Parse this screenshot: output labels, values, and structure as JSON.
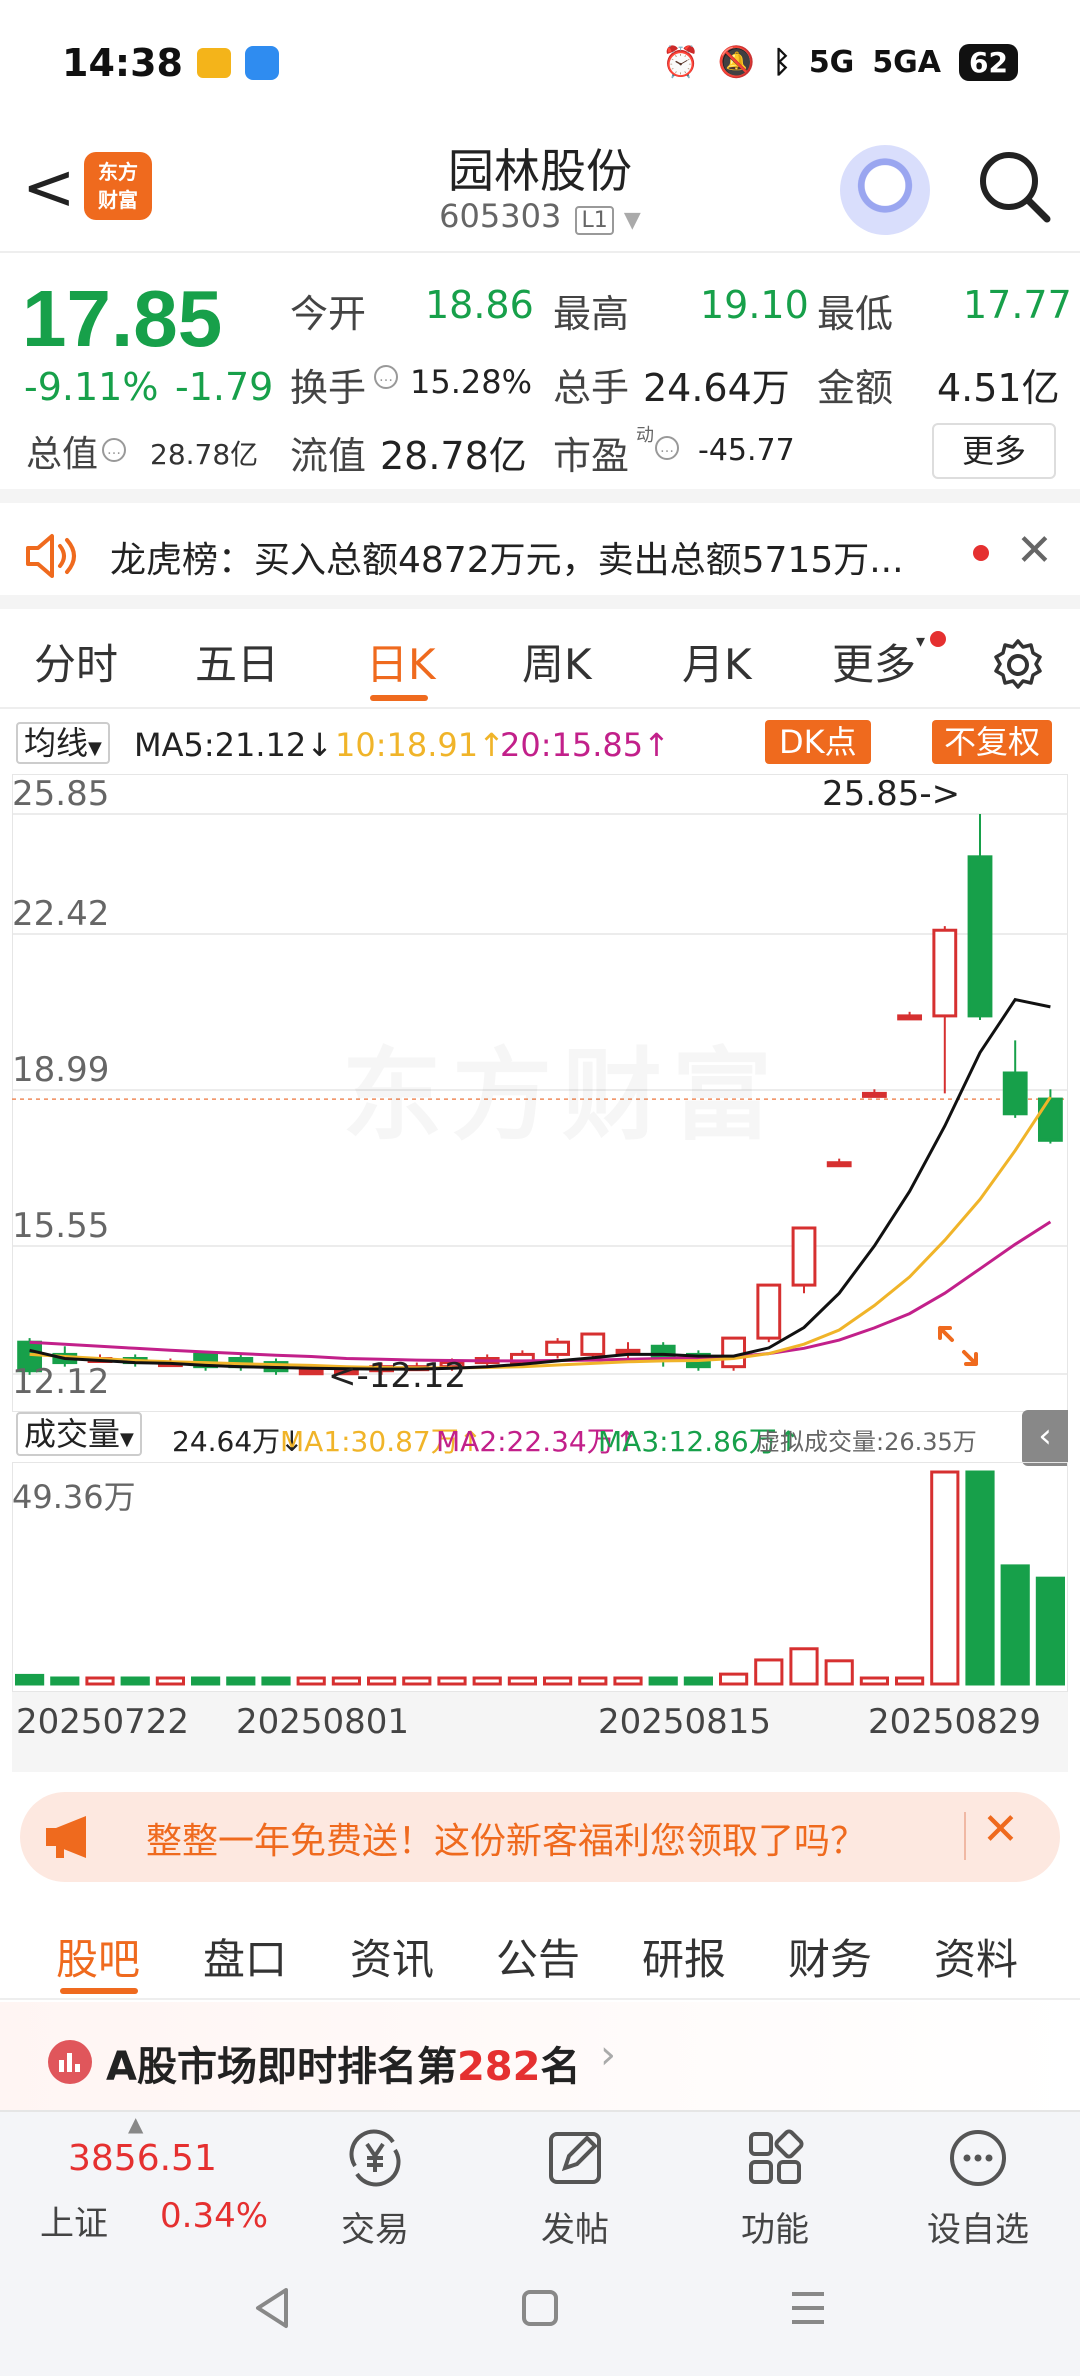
{
  "status_bar": {
    "time": "14:38",
    "signal_1": "5G",
    "signal_2": "5GA",
    "battery": "62"
  },
  "header": {
    "back_glyph": "<",
    "logo_line1": "东方",
    "logo_line2": "财富",
    "stock_name": "园林股份",
    "stock_code": "605303",
    "market_badge": "L1"
  },
  "quote": {
    "price": "17.85",
    "change_pct": "-9.11%",
    "change": "-1.79",
    "open_label": "今开",
    "open": "18.86",
    "high_label": "最高",
    "high": "19.10",
    "low_label": "最低",
    "low": "17.77",
    "turnover_label": "换手",
    "turnover": "15.28%",
    "volume_label": "总手",
    "volume": "24.64万",
    "amount_label": "金额",
    "amount": "4.51亿",
    "market_cap_label": "总值",
    "market_cap": "28.78亿",
    "float_cap_label": "流值",
    "float_cap": "28.78亿",
    "pe_label": "市盈",
    "pe_sup": "动",
    "pe": "-45.77",
    "more_label": "更多"
  },
  "notice": {
    "text": "龙虎榜：买入总额4872万元，卖出总额5715万..."
  },
  "chart_tabs": [
    "分时",
    "五日",
    "日K",
    "周K",
    "月K",
    "更多"
  ],
  "chart_tabs_active": "日K",
  "ma_legend": {
    "selector": "均线",
    "ma5": "MA5:21.12↓",
    "ma10": "10:18.91↑",
    "ma20": "20:15.85↑",
    "dk_button": "DK点",
    "fq_button": "不复权"
  },
  "price_axis": {
    "labels": [
      "25.85",
      "22.42",
      "18.99",
      "15.55",
      "12.12"
    ],
    "high_marker": "25.85->",
    "low_marker": "<-12.12",
    "watermark": "东方财富"
  },
  "vol_legend": {
    "selector": "成交量",
    "vol": "24.64万↓",
    "ma1": "MA1:30.87万↑",
    "ma2": "MA2:22.34万↑",
    "ma3": "MA3:12.86万↑",
    "virtual": "虚拟成交量:26.35万",
    "axis_max": "49.36万"
  },
  "date_axis": [
    "20250722",
    "20250801",
    "20250815",
    "20250829"
  ],
  "colors": {
    "up": "#d63030",
    "down": "#17a04a",
    "accent": "#ef6a1e",
    "ma5": "#111111",
    "ma10": "#f0b429",
    "ma20": "#c2208a"
  },
  "chart_data": {
    "type": "candlestick",
    "ylim": [
      12.12,
      25.85
    ],
    "candles": [
      {
        "o": 12.9,
        "c": 12.2,
        "h": 13.0,
        "l": 12.1,
        "v": 2.0
      },
      {
        "o": 12.6,
        "c": 12.4,
        "h": 12.8,
        "l": 12.3,
        "v": 0.8
      },
      {
        "o": 12.5,
        "c": 12.5,
        "h": 12.6,
        "l": 12.4,
        "v": 0.6
      },
      {
        "o": 12.5,
        "c": 12.4,
        "h": 12.6,
        "l": 12.3,
        "v": 0.8
      },
      {
        "o": 12.4,
        "c": 12.4,
        "h": 12.5,
        "l": 12.3,
        "v": 0.6
      },
      {
        "o": 12.6,
        "c": 12.3,
        "h": 12.6,
        "l": 12.2,
        "v": 0.7
      },
      {
        "o": 12.5,
        "c": 12.3,
        "h": 12.6,
        "l": 12.2,
        "v": 1.0
      },
      {
        "o": 12.4,
        "c": 12.2,
        "h": 12.5,
        "l": 12.1,
        "v": 0.6
      },
      {
        "o": 12.2,
        "c": 12.2,
        "h": 12.3,
        "l": 12.1,
        "v": 0.6
      },
      {
        "o": 12.2,
        "c": 12.2,
        "h": 12.3,
        "l": 12.1,
        "v": 0.7
      },
      {
        "o": 12.2,
        "c": 12.3,
        "h": 12.4,
        "l": 12.1,
        "v": 0.7
      },
      {
        "o": 12.3,
        "c": 12.3,
        "h": 12.4,
        "l": 12.2,
        "v": 0.7
      },
      {
        "o": 12.3,
        "c": 12.4,
        "h": 12.5,
        "l": 12.2,
        "v": 0.6
      },
      {
        "o": 12.4,
        "c": 12.5,
        "h": 12.6,
        "l": 12.3,
        "v": 1.0
      },
      {
        "o": 12.4,
        "c": 12.6,
        "h": 12.7,
        "l": 12.3,
        "v": 0.8
      },
      {
        "o": 12.6,
        "c": 12.9,
        "h": 13.0,
        "l": 12.5,
        "v": 0.8
      },
      {
        "o": 12.6,
        "c": 13.1,
        "h": 13.1,
        "l": 12.5,
        "v": 0.8
      },
      {
        "o": 12.7,
        "c": 12.7,
        "h": 12.9,
        "l": 12.5,
        "v": 0.8
      },
      {
        "o": 12.8,
        "c": 12.5,
        "h": 12.9,
        "l": 12.3,
        "v": 0.8
      },
      {
        "o": 12.6,
        "c": 12.3,
        "h": 12.7,
        "l": 12.2,
        "v": 0.8
      },
      {
        "o": 12.3,
        "c": 13.0,
        "h": 13.0,
        "l": 12.2,
        "v": 2.3
      },
      {
        "o": 13.0,
        "c": 14.3,
        "h": 14.3,
        "l": 12.9,
        "v": 5.6
      },
      {
        "o": 14.3,
        "c": 15.7,
        "h": 15.7,
        "l": 14.1,
        "v": 8.2
      },
      {
        "o": 17.3,
        "c": 17.3,
        "h": 17.4,
        "l": 17.3,
        "v": 5.4
      },
      {
        "o": 19.0,
        "c": 19.0,
        "h": 19.1,
        "l": 19.0,
        "v": 0.6
      },
      {
        "o": 20.9,
        "c": 20.9,
        "h": 21.0,
        "l": 20.9,
        "v": 0.4
      },
      {
        "o": 20.9,
        "c": 23.0,
        "h": 23.1,
        "l": 19.0,
        "v": 49.36
      },
      {
        "o": 24.8,
        "c": 20.9,
        "h": 25.85,
        "l": 20.8,
        "v": 49.36
      },
      {
        "o": 19.5,
        "c": 18.5,
        "h": 20.3,
        "l": 18.4,
        "v": 27.5
      },
      {
        "o": 18.86,
        "c": 17.85,
        "h": 19.1,
        "l": 17.77,
        "v": 24.64
      }
    ],
    "ma5": [
      12.7,
      12.5,
      12.45,
      12.4,
      12.38,
      12.33,
      12.3,
      12.28,
      12.26,
      12.25,
      12.24,
      12.24,
      12.26,
      12.3,
      12.36,
      12.44,
      12.52,
      12.6,
      12.6,
      12.56,
      12.56,
      12.76,
      13.26,
      14.1,
      15.26,
      16.6,
      18.2,
      20.0,
      21.3,
      21.12
    ],
    "ma10": [
      12.6,
      12.55,
      12.5,
      12.45,
      12.42,
      12.4,
      12.37,
      12.35,
      12.33,
      12.3,
      12.28,
      12.27,
      12.27,
      12.28,
      12.3,
      12.34,
      12.38,
      12.42,
      12.44,
      12.45,
      12.5,
      12.62,
      12.85,
      13.2,
      13.8,
      14.5,
      15.4,
      16.4,
      17.6,
      18.91
    ],
    "ma20": [
      12.9,
      12.85,
      12.8,
      12.75,
      12.7,
      12.66,
      12.62,
      12.58,
      12.55,
      12.5,
      12.48,
      12.46,
      12.45,
      12.44,
      12.44,
      12.45,
      12.46,
      12.48,
      12.5,
      12.52,
      12.55,
      12.62,
      12.75,
      12.95,
      13.25,
      13.6,
      14.1,
      14.7,
      15.3,
      15.85
    ]
  },
  "promo": {
    "text": "整整一年免费送！这份新客福利您领取了吗？"
  },
  "bottom_tabs": [
    "股吧",
    "盘口",
    "资讯",
    "公告",
    "研报",
    "财务",
    "资料"
  ],
  "rank": {
    "prefix": "A股市场即时排名第",
    "number": "282",
    "suffix": "名"
  },
  "dock": {
    "index_value": "3856.51",
    "index_name": "上证",
    "index_change": "0.34%",
    "trade": "交易",
    "post": "发帖",
    "function": "功能",
    "watchlist": "设自选"
  }
}
